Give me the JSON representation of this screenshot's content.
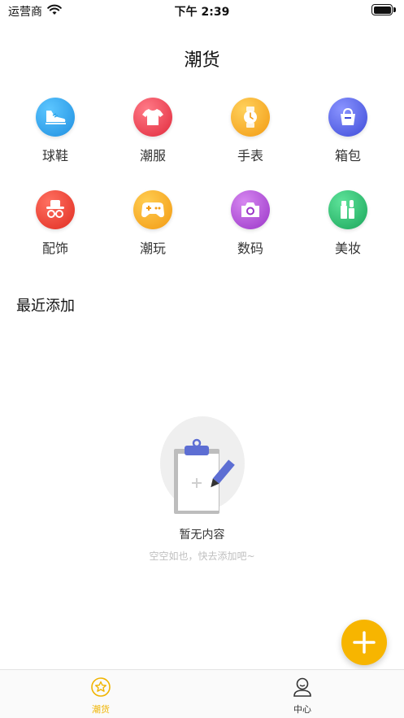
{
  "status_bar": {
    "carrier": "运营商",
    "time": "下午 2:39"
  },
  "header": {
    "title": "潮货"
  },
  "categories": [
    {
      "label": "球鞋",
      "icon": "sneaker-icon",
      "color": "#2aa3e8"
    },
    {
      "label": "潮服",
      "icon": "tshirt-icon",
      "color": "#ee3b4a"
    },
    {
      "label": "手表",
      "icon": "watch-icon",
      "color": "#f5a623"
    },
    {
      "label": "箱包",
      "icon": "bag-icon",
      "color": "#5a66e6"
    },
    {
      "label": "配饰",
      "icon": "hat-glasses-icon",
      "color": "#f2443a"
    },
    {
      "label": "潮玩",
      "icon": "gamepad-icon",
      "color": "#f5a623"
    },
    {
      "label": "数码",
      "icon": "camera-icon",
      "color": "#b54fd6"
    },
    {
      "label": "美妆",
      "icon": "cosmetics-icon",
      "color": "#27b96a"
    }
  ],
  "recent": {
    "title": "最近添加",
    "empty_title": "暂无内容",
    "empty_subtitle": "空空如也，快去添加吧~"
  },
  "tabbar": {
    "items": [
      {
        "label": "潮货",
        "icon": "star-icon",
        "active": true
      },
      {
        "label": "中心",
        "icon": "user-icon",
        "active": false
      }
    ]
  },
  "colors": {
    "accent": "#f7b500"
  }
}
